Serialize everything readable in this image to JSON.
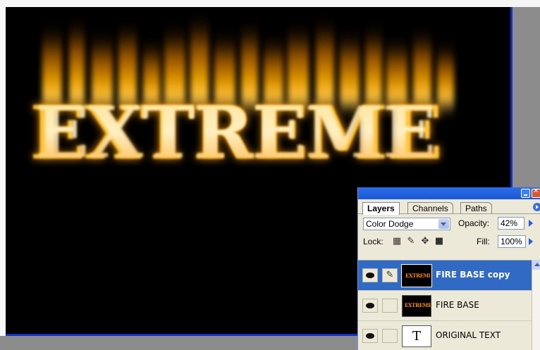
{
  "canvas": {
    "artwork_text": "EXTREME",
    "background_color": "#000000",
    "fire_color": "#ffb000"
  },
  "layers_palette": {
    "tabs": [
      "Layers",
      "Channels",
      "Paths"
    ],
    "active_tab": "Layers",
    "blend_mode": "Color Dodge",
    "opacity_label": "Opacity:",
    "opacity_value": "42%",
    "lock_label": "Lock:",
    "fill_label": "Fill:",
    "fill_value": "100%",
    "layers": [
      {
        "name": "FIRE BASE copy",
        "selected": true,
        "thumb_text": "EXTREME"
      },
      {
        "name": "FIRE BASE",
        "selected": false,
        "thumb_text": "EXTREME"
      },
      {
        "name": "ORIGINAL TEXT",
        "selected": false,
        "thumb_text": "T"
      }
    ]
  },
  "colors": {
    "selection": "#316ac5",
    "titlebar": "#1b56d6",
    "window_border": "#1030c8"
  }
}
